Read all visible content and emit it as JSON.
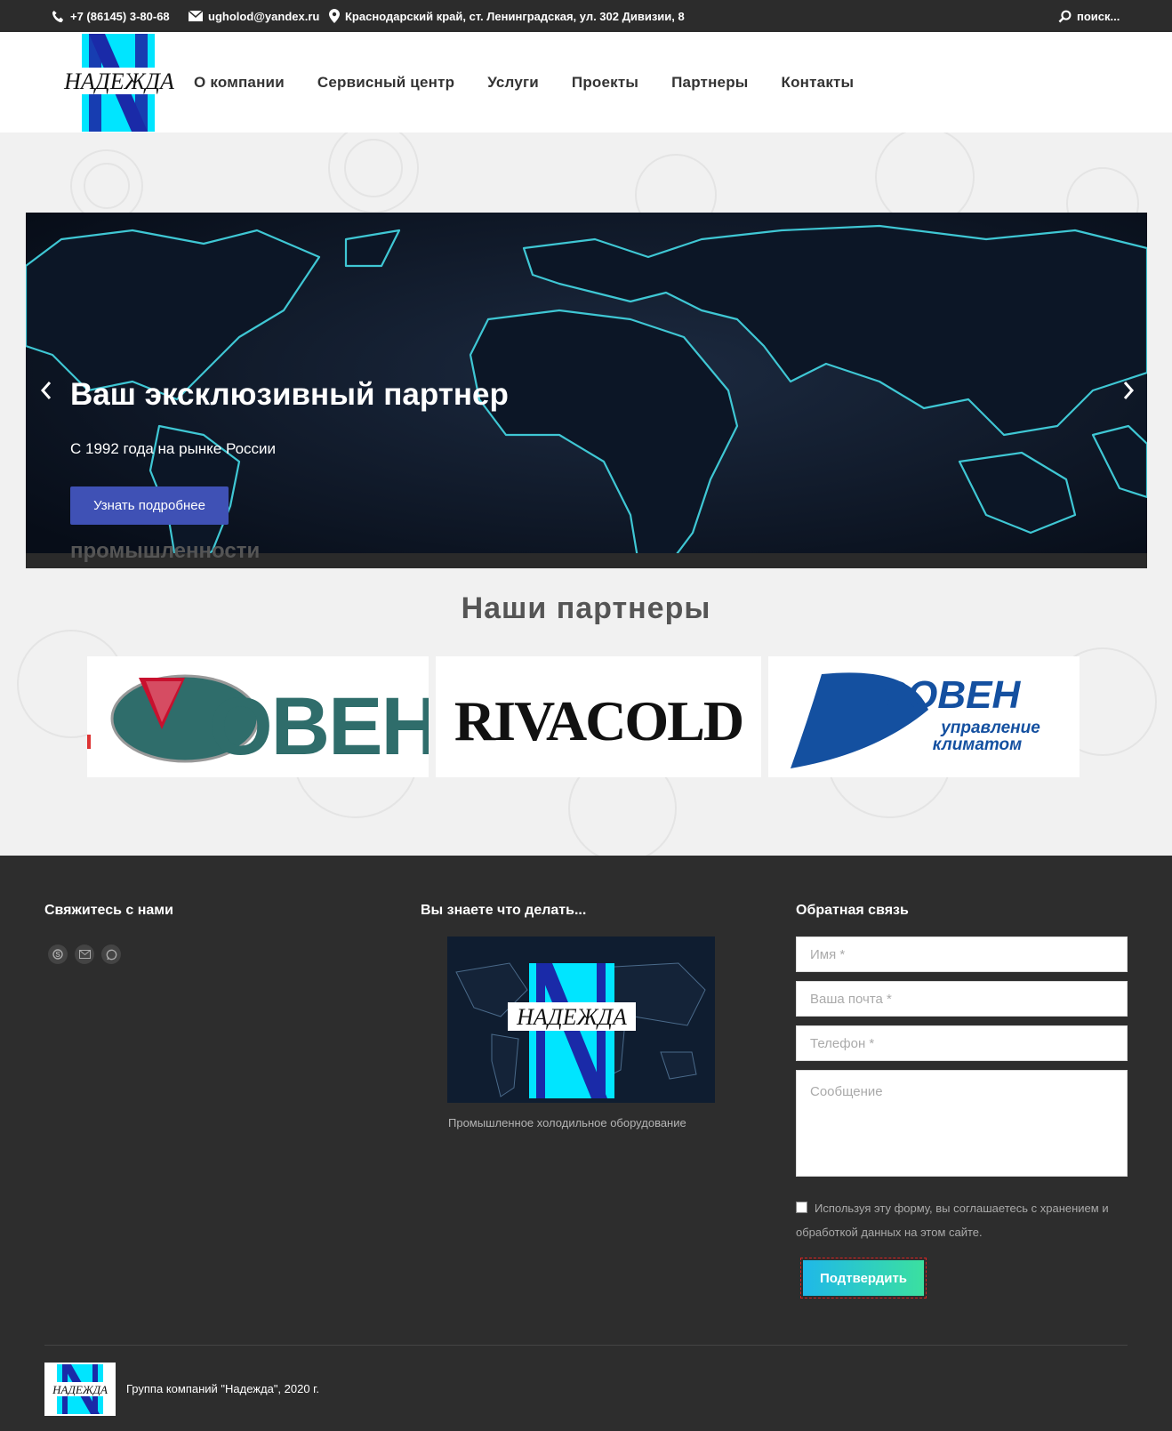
{
  "topbar": {
    "phone": "+7 (86145) 3-80-68",
    "email": "ugholod@yandex.ru",
    "address": "Краснодарский край, ст. Ленинградская, ул. 302 Дивизии, 8",
    "search": "поиск..."
  },
  "logo": {
    "text": "НАДЕЖДА"
  },
  "nav": [
    "О компании",
    "Сервисный центр",
    "Услуги",
    "Проекты",
    "Партнеры",
    "Контакты"
  ],
  "slider": {
    "title": "Ваш эксклюзивный партнер",
    "subtitle": "С 1992 года на рынке России",
    "button": "Узнать подробнее",
    "peek_text": "промышленности"
  },
  "partners": {
    "title": "Наши партнеры",
    "logos": [
      "ОВЕН",
      "RIVACOLD",
      "РОВЕН",
      "управление",
      "климатом"
    ]
  },
  "footer": {
    "contact_title": "Свяжитесь с нами",
    "know_title": "Вы знаете что делать...",
    "know_caption": "Промышленное холодильное оборудование",
    "feedback_title": "Обратная связь",
    "form": {
      "name": "Имя *",
      "email": "Ваша почта *",
      "phone": "Телефон *",
      "message": "Сообщение",
      "consent": "Используя эту форму, вы соглашаетесь с хранением и обработкой данных на этом сайте.",
      "submit": "Подтвердить"
    },
    "copyright": "Группа компаний \"Надежда\", 2020 г."
  },
  "icons": {
    "phone": "phone-icon",
    "email": "envelope-icon",
    "address": "map-pin-icon",
    "search": "search-icon",
    "social": [
      "skype-icon",
      "mail-icon",
      "whatsapp-icon"
    ]
  },
  "colors": {
    "accent": "#3f51b5",
    "brand_cyan": "#00e5ff",
    "brand_blue": "#1a2aa8",
    "footer_bg": "#2d2d2d"
  }
}
